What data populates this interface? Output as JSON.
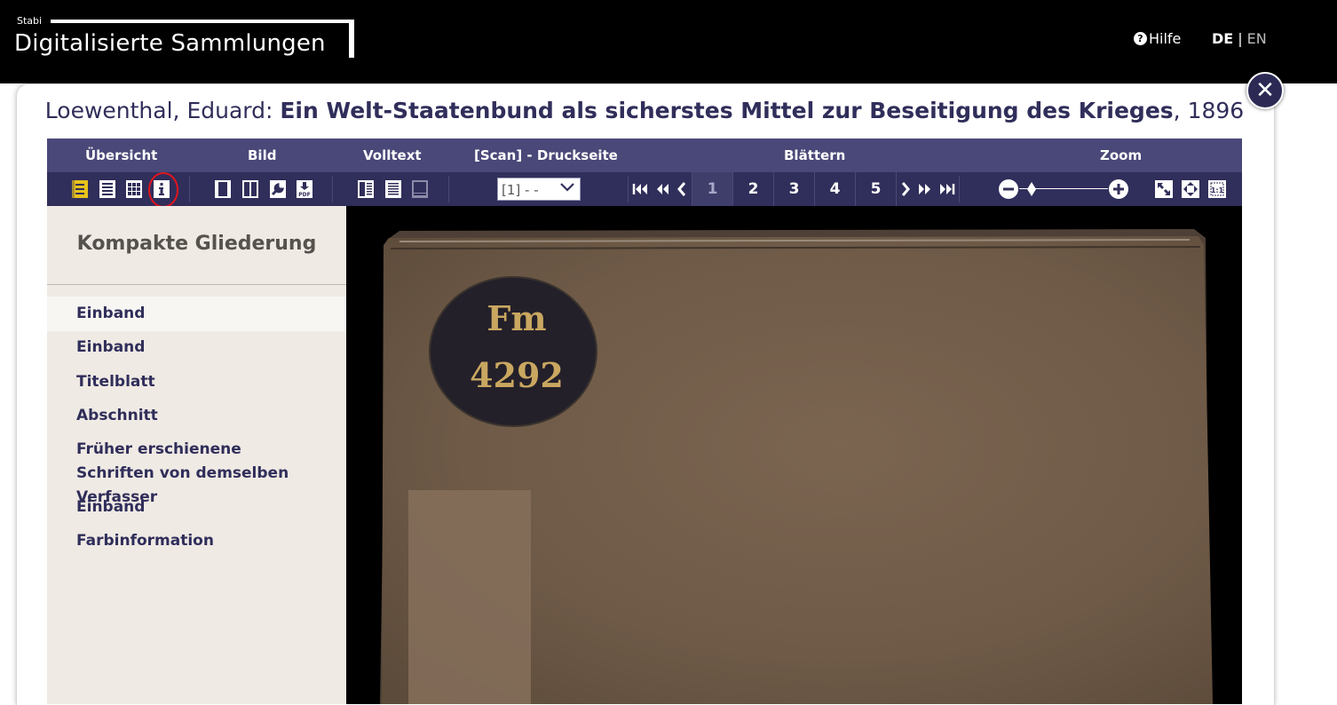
{
  "header": {
    "logo_small": "Stabi",
    "logo_name": "Digitalisierte Sammlungen",
    "help_label": "Hilfe",
    "lang_de": "DE",
    "lang_sep": "|",
    "lang_en": "EN"
  },
  "title": {
    "author": "Loewenthal, Eduard:",
    "work": "Ein Welt-Staatenbund als sicherstes Mittel zur Beseitigung des Krieges",
    "year": ", 1896"
  },
  "toolbar": {
    "groups": [
      "Übersicht",
      "Bild",
      "Volltext",
      "[Scan] - Druckseite",
      "Blättern",
      "Zoom"
    ],
    "page_select_value": "[1] - -",
    "pages": [
      "1",
      "2",
      "3",
      "4",
      "5"
    ],
    "active_page": "1"
  },
  "sidebar": {
    "title": "Kompakte Gliederung",
    "items": [
      {
        "label": "Einband"
      },
      {
        "label": "Einband"
      },
      {
        "label": "Titelblatt"
      },
      {
        "label": "Abschnitt"
      },
      {
        "label": "Früher erschienene Schriften von demselben Verfasser"
      },
      {
        "label": "Einband"
      },
      {
        "label": "Farbinformation"
      }
    ]
  },
  "scan": {
    "label_line1": "Fm",
    "label_line2": "4292"
  },
  "colors": {
    "accent": "#302e5a",
    "toolbar_head": "#4a4878",
    "sidebar_bg": "#efeae4",
    "highlight_circle": "#e0141e",
    "cover_brown": "#6e5a47"
  }
}
